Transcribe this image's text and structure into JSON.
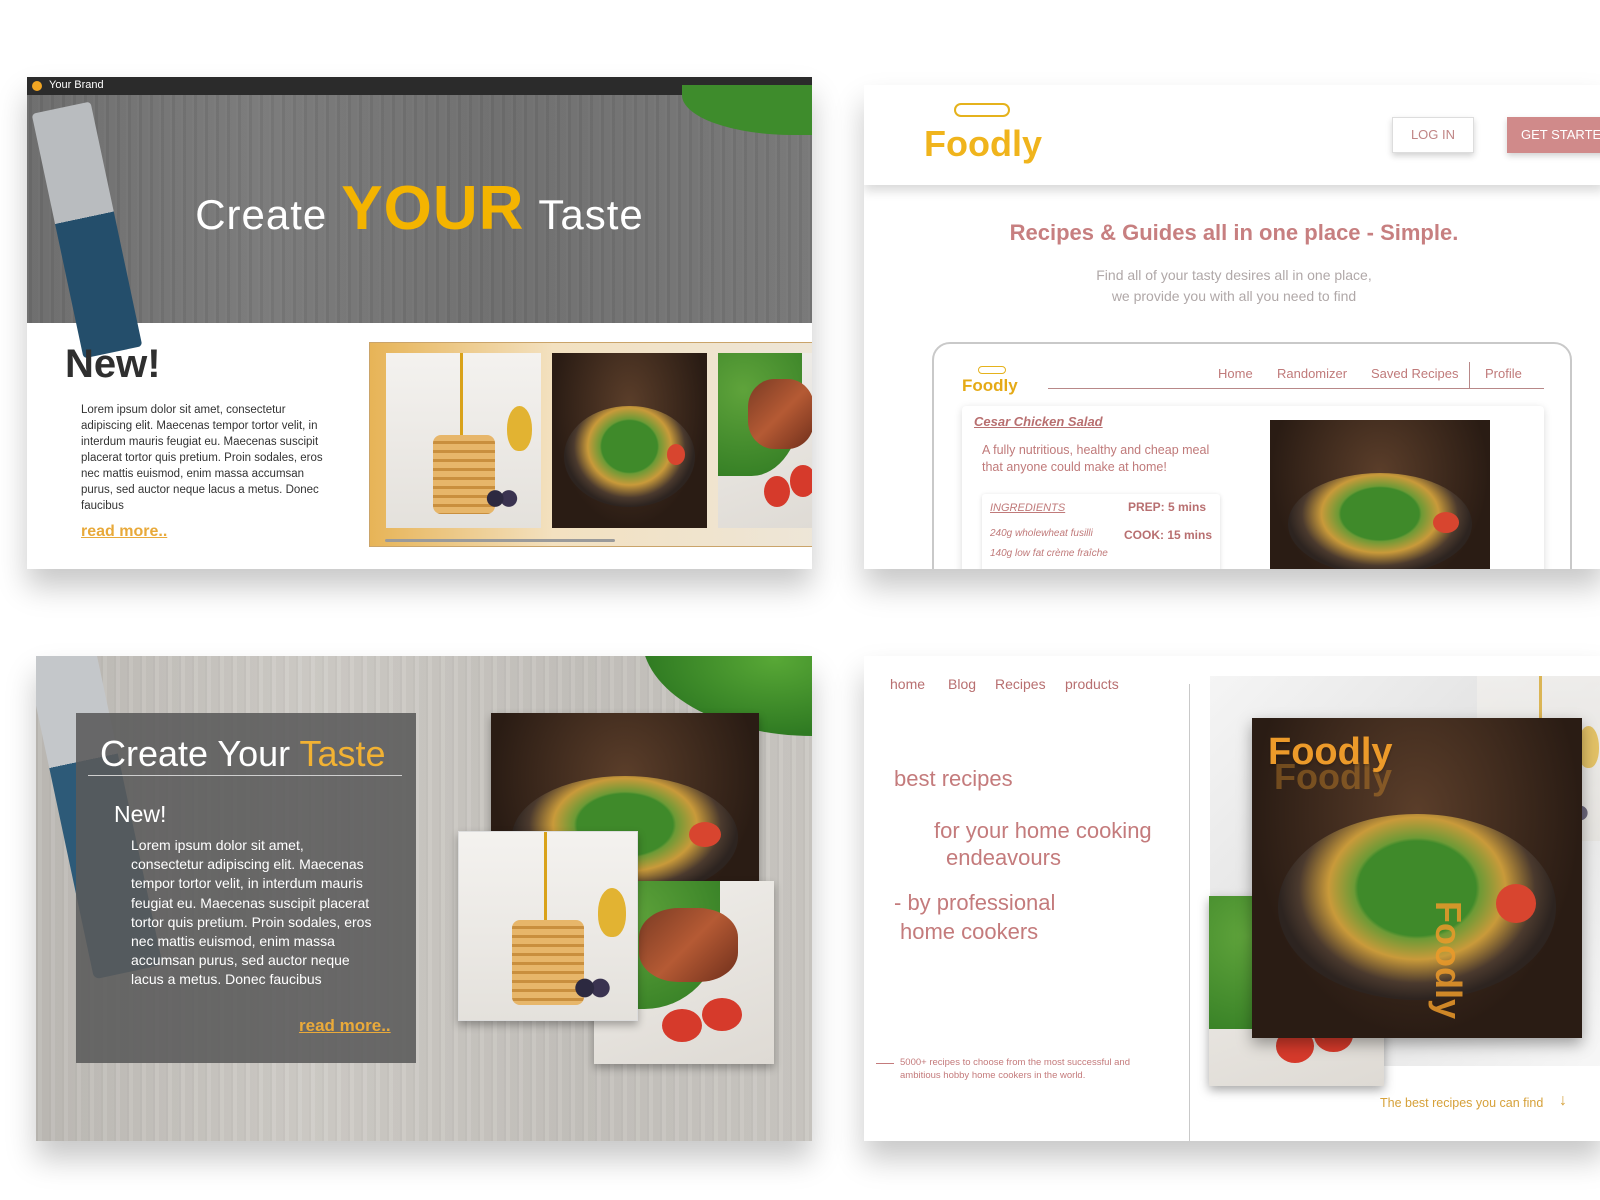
{
  "panel1": {
    "brand": "Your Brand",
    "hero_title_left": "Create",
    "hero_title_big": "YOUR",
    "hero_title_right": "Taste",
    "new_title": "New!",
    "lorem": "Lorem ipsum dolor sit amet, consectetur adipiscing elit. Maecenas tempor tortor velit, in interdum mauris feugiat eu. Maecenas suscipit placerat tortor quis pretium. Proin sodales, eros nec mattis euismod, enim massa accumsan purus, sed auctor neque lacus a metus. Donec faucibus",
    "read_more": "read more.."
  },
  "panel2": {
    "logo": "Foodly",
    "login": "LOG IN",
    "get_started": "GET STARTED",
    "headline": "Recipes & Guides all in one place - Simple.",
    "sub_line1": "Find all of your tasty desires all in one place,",
    "sub_line2": "we provide you with all you need to find",
    "device": {
      "logo": "Foodly",
      "nav": [
        "Home",
        "Randomizer",
        "Saved Recipes",
        "Profile"
      ],
      "recipe_title": "Cesar Chicken Salad",
      "recipe_desc": "A fully nutritious, healthy and cheap meal that anyone could make at home!",
      "ingredients_label": "INGREDIENTS",
      "prep": "PREP:  5 mins",
      "cook": "COOK: 15 mins",
      "ingredient1": "240g wholewheat fusilli",
      "ingredient2": "140g low fat crème fraîche"
    }
  },
  "panel3": {
    "title_main": "Create Your",
    "title_accent": "Taste",
    "new_label": "New!",
    "lorem": "Lorem ipsum dolor sit amet, consectetur adipiscing elit. Maecenas tempor tortor velit, in interdum mauris feugiat eu. Maecenas suscipit placerat tortor quis pretium. Proin sodales, eros nec mattis euismod, enim massa accumsan purus, sed auctor neque lacus a metus. Donec faucibus",
    "read_more": "read more.."
  },
  "panel4": {
    "nav": [
      "home",
      "Blog",
      "Recipes",
      "products"
    ],
    "line1": "best recipes",
    "line2a": "for your home cooking",
    "line2b": "endeavours",
    "line3a": "- by professional",
    "line3b": "home cookers",
    "small_text": "5000+ recipes to choose from the most successful and ambitious hobby home cookers in the world.",
    "logo": "Foodly",
    "caption": "The best recipes you can find",
    "arrow_icon": "arrow-down"
  },
  "colors": {
    "accent_yellow": "#f4b400",
    "accent_rose": "#c77f80",
    "button_rose": "#d08a8a"
  }
}
